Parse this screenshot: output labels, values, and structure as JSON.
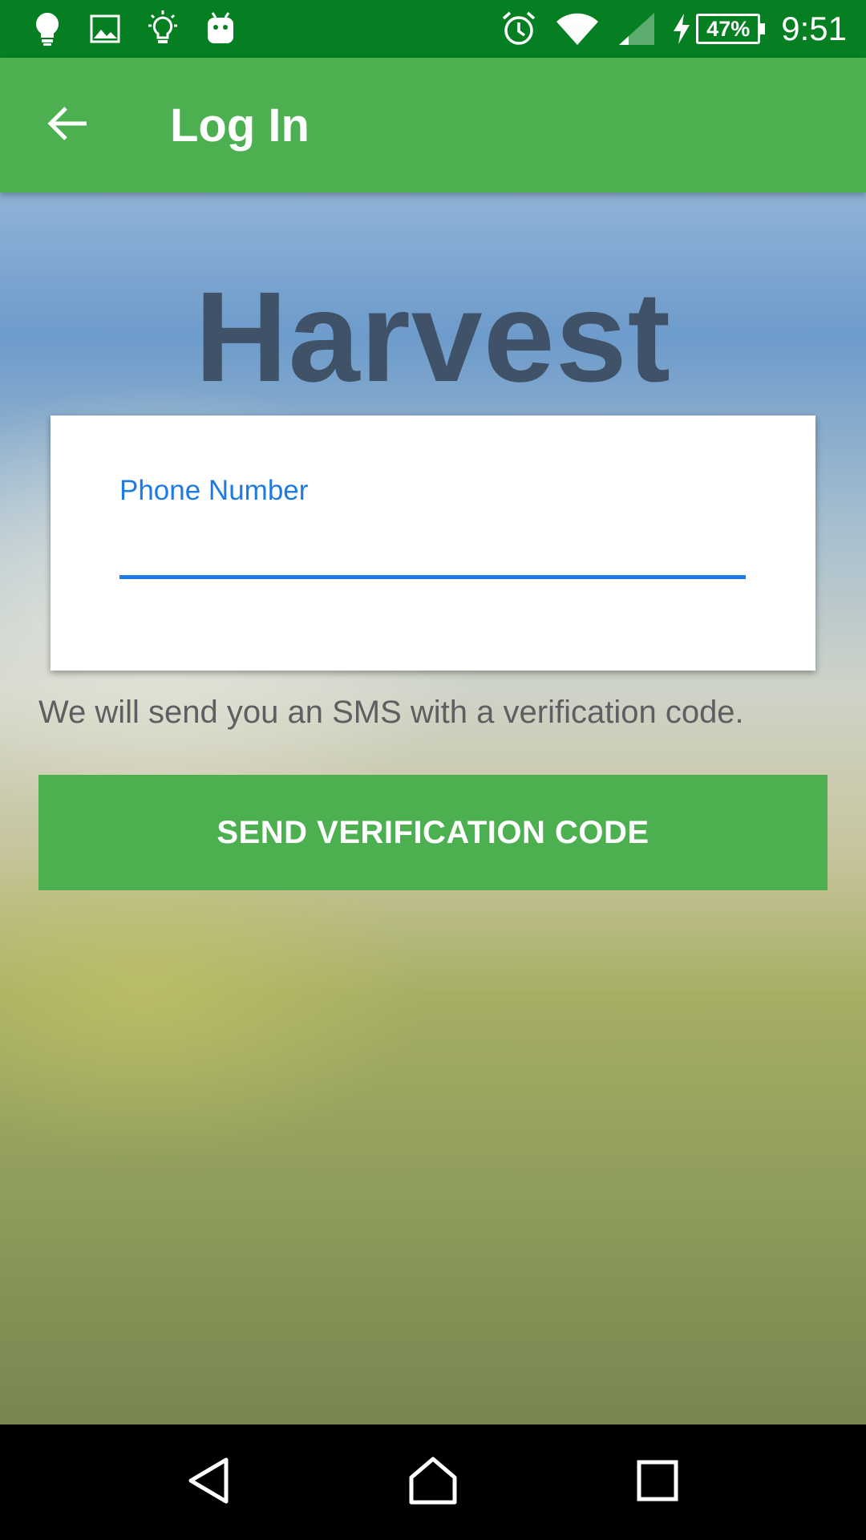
{
  "status_bar": {
    "icons_left": [
      "lightbulb-icon",
      "image-icon",
      "lightbulb-outline-icon",
      "android-icon"
    ],
    "icons_right": [
      "alarm-icon",
      "wifi-icon",
      "signal-icon",
      "charging-icon"
    ],
    "battery": "47%",
    "time": "9:51"
  },
  "app_bar": {
    "title": "Log In",
    "back_icon": "arrow-back-icon"
  },
  "brand": "Harvest",
  "form": {
    "phone_label": "Phone Number",
    "phone_value": "",
    "helper_text": "We will send you an SMS with a verification code.",
    "send_button": "SEND VERIFICATION CODE"
  },
  "nav_bar": {
    "icons": [
      "back-triangle-icon",
      "home-icon",
      "recents-icon"
    ]
  },
  "colors": {
    "status_bar": "#067F22",
    "app_bar": "#4CAF50",
    "accent": "#1E7BE6",
    "brand_text": "#3F5268",
    "button": "#4CAF50"
  }
}
